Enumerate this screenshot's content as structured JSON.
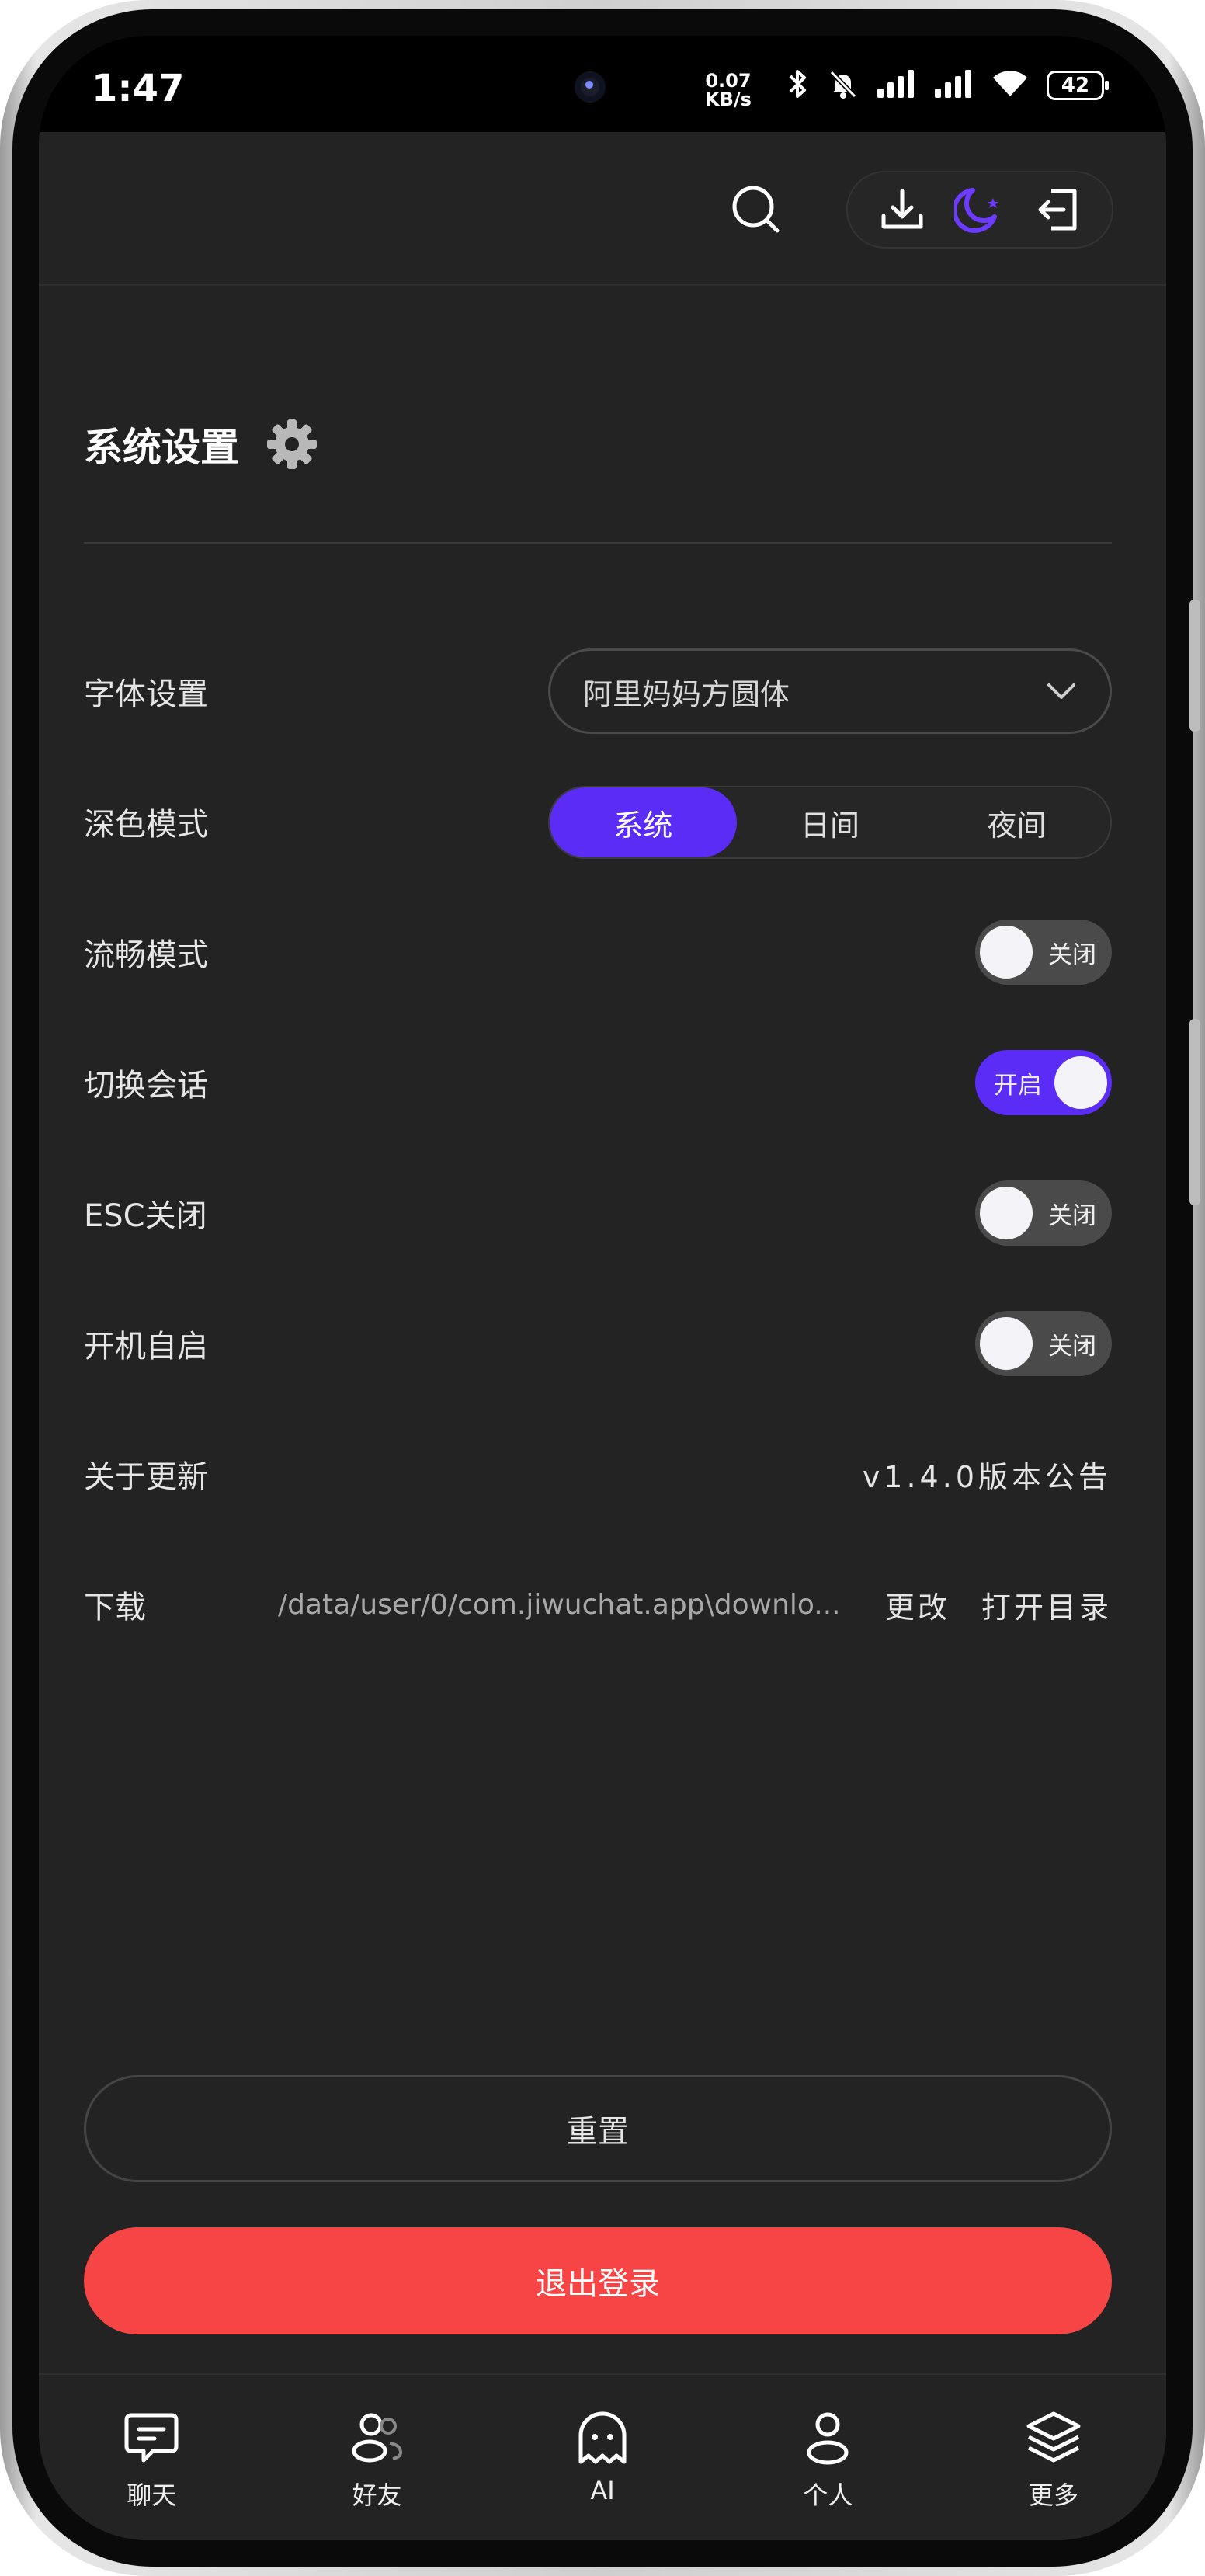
{
  "status_bar": {
    "time": "1:47",
    "net_speed_value": "0.07",
    "net_speed_unit": "KB/s",
    "battery": "42"
  },
  "settings": {
    "title": "系统设置",
    "font": {
      "label": "字体设置",
      "value": "阿里妈妈方圆体"
    },
    "dark_mode": {
      "label": "深色模式",
      "options": [
        "系统",
        "日间",
        "夜间"
      ],
      "selected": "系统"
    },
    "smooth_mode": {
      "label": "流畅模式",
      "state": "关闭"
    },
    "switch_session": {
      "label": "切换会话",
      "state": "开启"
    },
    "esc_close": {
      "label": "ESC关闭",
      "state": "关闭"
    },
    "autostart": {
      "label": "开机自启",
      "state": "关闭"
    },
    "update": {
      "label": "关于更新",
      "link": "v1.4.0版本公告"
    },
    "download": {
      "label": "下载",
      "path": "/data/user/0/com.jiwuchat.app\\downlo...",
      "change": "更改",
      "open_dir": "打开目录"
    }
  },
  "buttons": {
    "reset": "重置",
    "logout": "退出登录"
  },
  "nav": {
    "items": [
      {
        "label": "聊天",
        "icon": "chat-icon"
      },
      {
        "label": "好友",
        "icon": "friends-icon"
      },
      {
        "label": "AI",
        "icon": "ghost-icon"
      },
      {
        "label": "个人",
        "icon": "person-icon"
      },
      {
        "label": "更多",
        "icon": "layers-icon"
      }
    ]
  },
  "colors": {
    "accent": "#5a2cf5",
    "danger": "#f74545",
    "background": "#232323"
  }
}
